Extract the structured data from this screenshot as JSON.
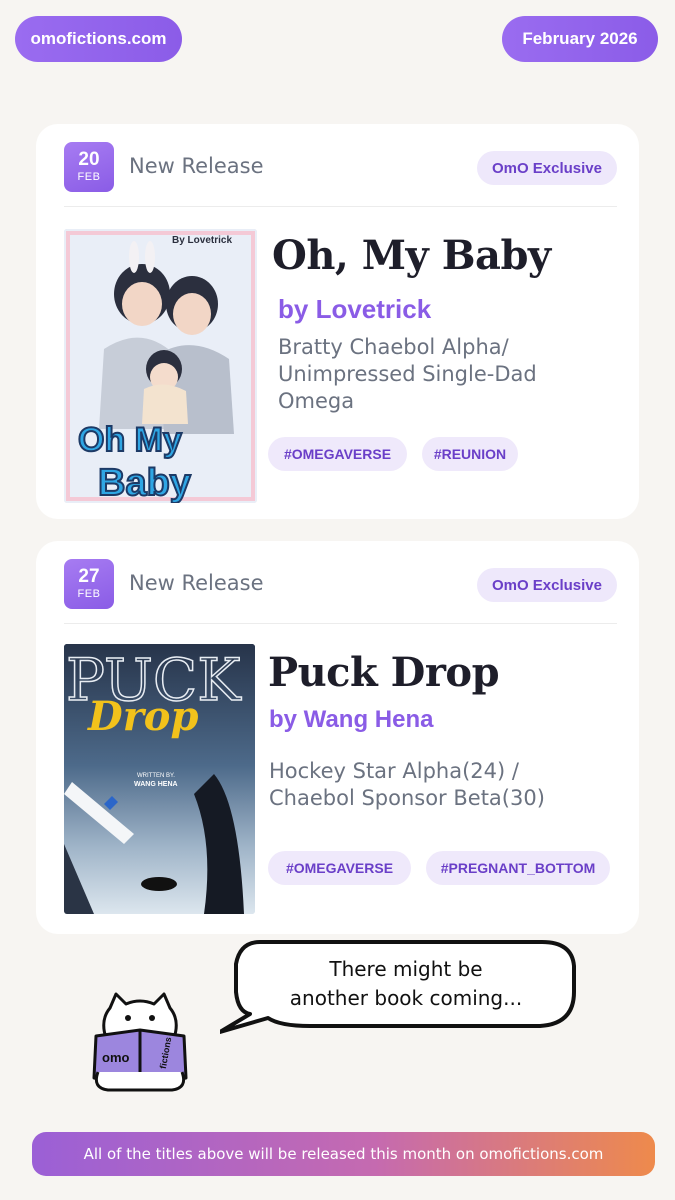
{
  "header": {
    "site_label": "omofictions.com",
    "month_label": "February 2026"
  },
  "releases": [
    {
      "day": "20",
      "month": "FEB",
      "release_label": "New Release",
      "exclusive_label": "OmO Exclusive",
      "title": "Oh, My Baby",
      "author": "by Lovetrick",
      "description": "Bratty Chaebol Alpha/ Unimpressed Single-Dad Omega",
      "tags": [
        "#OMEGAVERSE",
        "#REUNION"
      ],
      "cover_brand": "By Lovetrick",
      "cover_title_1": "Oh My",
      "cover_title_2": "Baby"
    },
    {
      "day": "27",
      "month": "FEB",
      "release_label": "New Release",
      "exclusive_label": "OmO Exclusive",
      "title": "Puck Drop",
      "author": "by Wang Hena",
      "description": "Hockey Star Alpha(24) / Chaebol Sponsor Beta(30)",
      "tags": [
        "#OMEGAVERSE",
        "#PREGNANT_BOTTOM"
      ],
      "cover_title_1": "PUCK",
      "cover_title_2": "Drop",
      "cover_credit_1": "WRITTEN BY.",
      "cover_credit_2": "WANG HENA"
    }
  ],
  "speech": {
    "line1": "There might be",
    "line2": "another book coming..."
  },
  "mascot": {
    "book_left": "omo",
    "book_right": "fictions"
  },
  "footer": {
    "text": "All of the titles above will be released this month on omofictions.com"
  }
}
